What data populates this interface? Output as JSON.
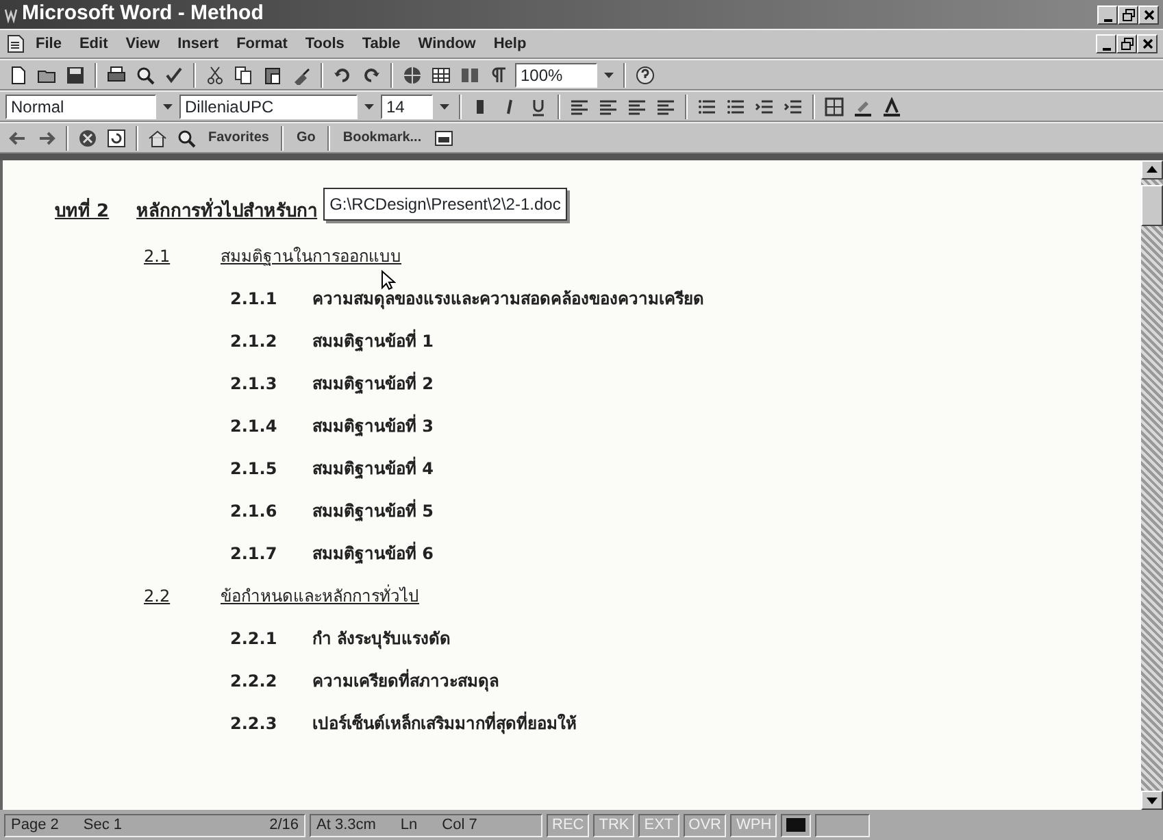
{
  "window": {
    "title": "Microsoft Word - Method"
  },
  "menu": [
    "File",
    "Edit",
    "View",
    "Insert",
    "Format",
    "Tools",
    "Table",
    "Window",
    "Help"
  ],
  "standard_toolbar": {
    "zoom": "100%"
  },
  "formatting_toolbar": {
    "style": "Normal",
    "font": "DilleniaUPC",
    "size": "14"
  },
  "web_toolbar": {
    "favorites": "Favorites",
    "go": "Go",
    "bookmark": "Bookmark..."
  },
  "document": {
    "heading": {
      "number": "บทที่ 2",
      "text": "หลักการทั่วไปสำหรับกา"
    },
    "tooltip": "G:\\RCDesign\\Present\\2\\2-1.doc",
    "sections": [
      {
        "number": "2.1",
        "title": "สมมติฐานในการออกแบบ",
        "items": [
          {
            "number": "2.1.1",
            "text": "ความสมดุลของแรงและความสอดคล้องของความเครียด"
          },
          {
            "number": "2.1.2",
            "text": "สมมติฐานข้อที่ 1"
          },
          {
            "number": "2.1.3",
            "text": "สมมติฐานข้อที่ 2"
          },
          {
            "number": "2.1.4",
            "text": "สมมติฐานข้อที่ 3"
          },
          {
            "number": "2.1.5",
            "text": "สมมติฐานข้อที่ 4"
          },
          {
            "number": "2.1.6",
            "text": "สมมติฐานข้อที่ 5"
          },
          {
            "number": "2.1.7",
            "text": "สมมติฐานข้อที่ 6"
          }
        ]
      },
      {
        "number": "2.2",
        "title": "ข้อกำหนดและหลักการทั่วไป",
        "items": [
          {
            "number": "2.2.1",
            "text": "กำ ลังระบุรับแรงดัด"
          },
          {
            "number": "2.2.2",
            "text": "ความเครียดที่สภาวะสมดุล"
          },
          {
            "number": "2.2.3",
            "text": "เปอร์เซ็นต์เหล็กเสริมมากที่สุดที่ยอมให้"
          }
        ]
      }
    ]
  },
  "status_bar": {
    "page": "Page 2",
    "section": "Sec 1",
    "pages": "2/16",
    "at": "At 3.3cm",
    "line": "Ln",
    "column": "Col 7",
    "modes": [
      {
        "label": "REC",
        "on": false
      },
      {
        "label": "TRK",
        "on": false
      },
      {
        "label": "EXT",
        "on": false
      },
      {
        "label": "OVR",
        "on": false
      },
      {
        "label": "WPH",
        "on": false
      }
    ]
  }
}
